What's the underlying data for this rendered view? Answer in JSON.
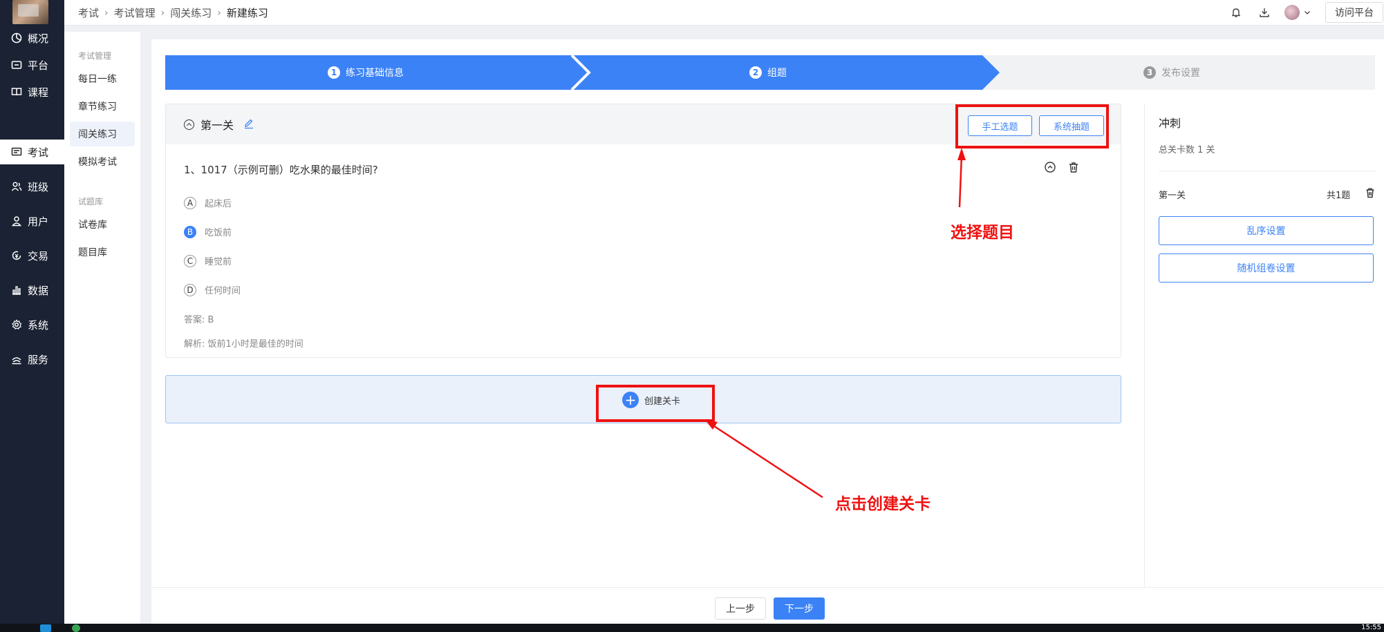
{
  "sidebar": {
    "items": [
      {
        "label": "概况",
        "icon": "dashboard-icon"
      },
      {
        "label": "平台",
        "icon": "platform-icon"
      },
      {
        "label": "课程",
        "icon": "book-icon"
      },
      {
        "label": "考试",
        "icon": "exam-icon",
        "active": true
      },
      {
        "label": "班级",
        "icon": "class-icon"
      },
      {
        "label": "用户",
        "icon": "user-icon"
      },
      {
        "label": "交易",
        "icon": "trade-icon"
      },
      {
        "label": "数据",
        "icon": "chart-icon"
      },
      {
        "label": "系统",
        "icon": "gear-icon"
      },
      {
        "label": "服务",
        "icon": "service-icon"
      }
    ]
  },
  "header": {
    "breadcrumb": [
      "考试",
      "考试管理",
      "闯关练习",
      "新建练习"
    ],
    "visit_label": "访问平台"
  },
  "subnav": {
    "group1": "考试管理",
    "items1": [
      "每日一练",
      "章节练习",
      "闯关练习",
      "模拟考试"
    ],
    "group2": "试题库",
    "items2": [
      "试卷库",
      "题目库"
    ]
  },
  "steps": [
    {
      "num": "1",
      "label": "练习基础信息",
      "state": "done"
    },
    {
      "num": "2",
      "label": "组题",
      "state": "active"
    },
    {
      "num": "3",
      "label": "发布设置",
      "state": "todo"
    }
  ],
  "level": {
    "title": "第一关",
    "manual_btn": "手工选题",
    "system_btn": "系统抽题",
    "question": "1、1017（示例可删）吃水果的最佳时间?",
    "options": [
      {
        "letter": "A",
        "text": "起床后",
        "selected": false
      },
      {
        "letter": "B",
        "text": "吃饭前",
        "selected": true
      },
      {
        "letter": "C",
        "text": "睡觉前",
        "selected": false
      },
      {
        "letter": "D",
        "text": "任何时间",
        "selected": false
      }
    ],
    "answer": "答案:  B",
    "analysis": "解析:  饭前1小时是最佳的时间"
  },
  "create_level": "创建关卡",
  "right_panel": {
    "title": "冲刺",
    "total": "总关卡数 1 关",
    "level_name": "第一关",
    "level_count": "共1题",
    "shuffle_btn": "乱序设置",
    "random_btn": "随机组卷设置"
  },
  "footer": {
    "prev": "上一步",
    "next": "下一步"
  },
  "annotations": {
    "select_question": "选择题目",
    "click_create": "点击创建关卡"
  },
  "taskbar": {
    "clock": "15:55"
  },
  "colors": {
    "accent": "#3b82f6",
    "sidebar_bg": "#1a2233",
    "annotation_red": "#ee1111"
  }
}
